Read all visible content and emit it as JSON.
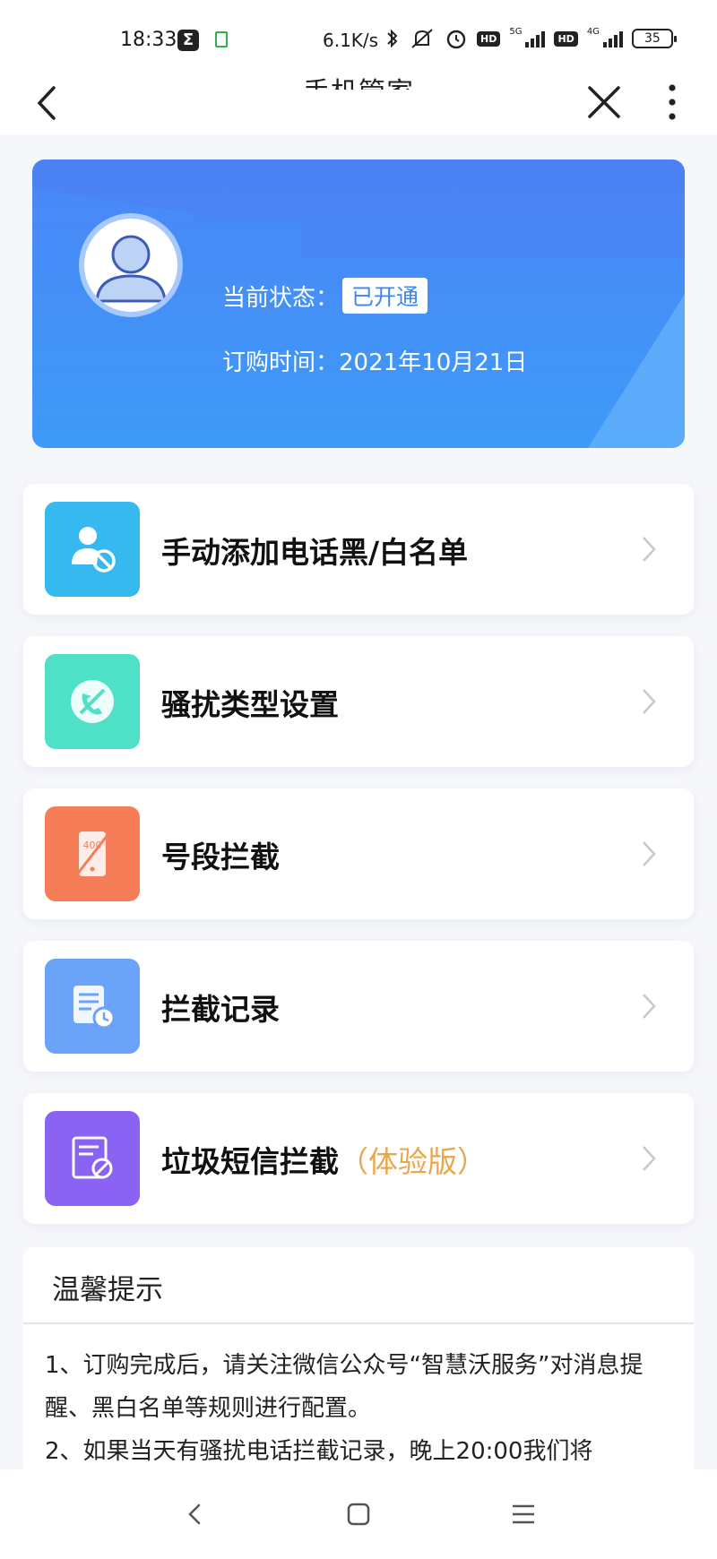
{
  "status_bar": {
    "time": "18:33",
    "speed": "6.1K/s",
    "battery": "35",
    "net1": "5G",
    "net2": "4G",
    "hd": "HD"
  },
  "nav": {
    "title": "手机管家"
  },
  "header": {
    "status_label": "当前状态：",
    "status_value": "已开通",
    "order_time": "订购时间：2021年10月21日"
  },
  "menu": [
    {
      "label": "手动添加电话黑/白名单",
      "icon": "person-block-icon",
      "color": "#35b9ee"
    },
    {
      "label": "骚扰类型设置",
      "icon": "phone-block-icon",
      "color": "#4fe0c8"
    },
    {
      "label": "号段拦截",
      "icon": "number-segment-icon",
      "color": "#f57d57"
    },
    {
      "label": "拦截记录",
      "icon": "record-clock-icon",
      "color": "#6aa3f8"
    },
    {
      "label": "垃圾短信拦截",
      "trial": "（体验版）",
      "icon": "message-block-icon",
      "color": "#8a63f3"
    }
  ],
  "tips": {
    "title": "温馨提示",
    "line1": "1、订购完成后，请关注微信公众号“智慧沃服务”对消息提醒、黑白名单等规则进行配置。",
    "line2": "2、如果当天有骚扰电话拦截记录，晚上20:00我们将"
  },
  "icon_labels": {
    "number_segment_text": "400"
  }
}
